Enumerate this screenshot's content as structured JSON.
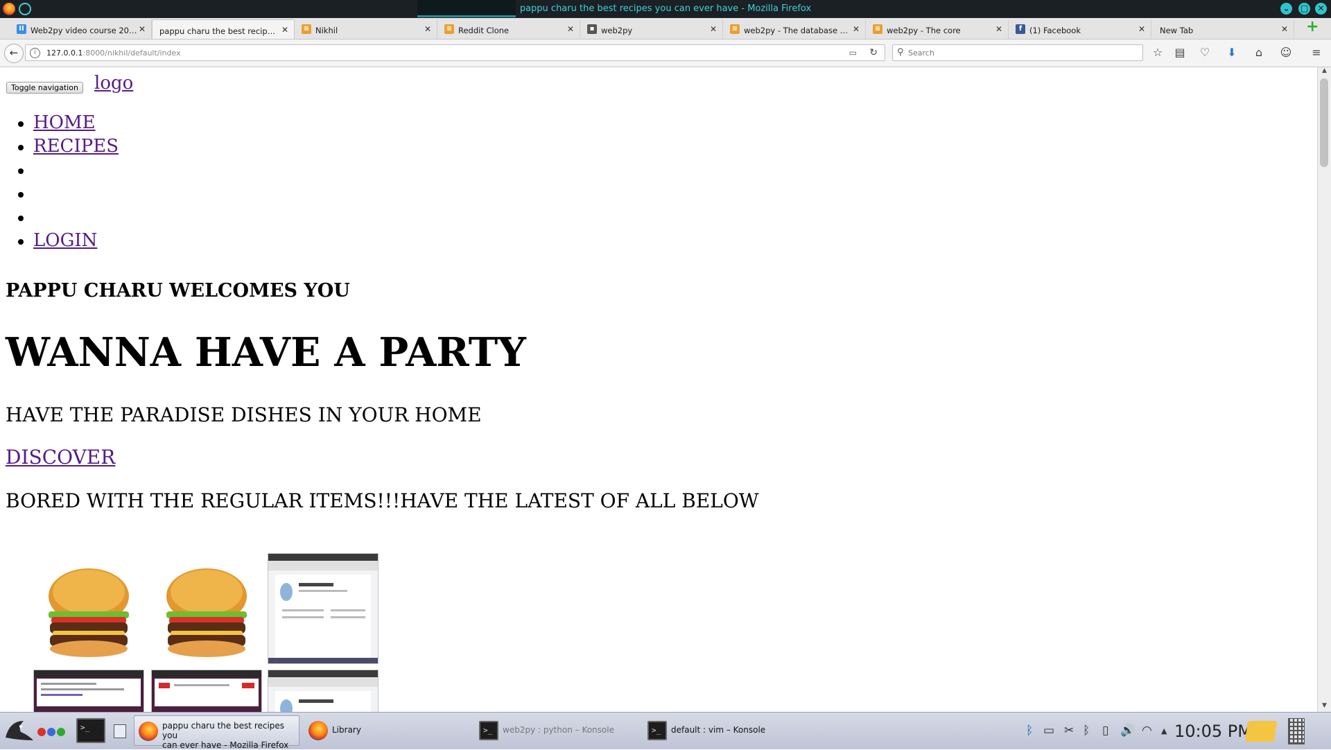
{
  "window": {
    "title": "pappu charu the best recipes you can ever have - Mozilla Firefox"
  },
  "tabs": [
    {
      "label": "Web2py video course 20…",
      "favicon": "video-course-icon",
      "color": "#3a8ee6"
    },
    {
      "label": "pappu charu the best recip…",
      "favicon": "page-icon",
      "active": true
    },
    {
      "label": "Nikhil",
      "favicon": "web2py-icon",
      "color": "#e8a030"
    },
    {
      "label": "Reddit Clone",
      "favicon": "web2py-icon",
      "color": "#e8a030"
    },
    {
      "label": "web2py",
      "favicon": "github-icon",
      "color": "#555555"
    },
    {
      "label": "web2py - The database …",
      "favicon": "web2py-icon",
      "color": "#e8a030"
    },
    {
      "label": "web2py - The core",
      "favicon": "web2py-icon",
      "color": "#e8a030"
    },
    {
      "label": "(1) Facebook",
      "favicon": "facebook-icon",
      "color": "#3b5998"
    },
    {
      "label": "New Tab",
      "favicon": "none"
    }
  ],
  "navbar": {
    "url_host": "127.0.0.1",
    "url_rest": ":8000/nikhil/default/index",
    "search_placeholder": "Search"
  },
  "page": {
    "toggle_label": "Toggle navigation",
    "logo_label": "logo",
    "nav_items": [
      "HOME",
      "RECIPES",
      "",
      "",
      "",
      "LOGIN"
    ],
    "welcome": "PAPPU CHARU WELCOMES YOU",
    "party": "WANNA HAVE A PARTY",
    "paradise": "HAVE THE PARADISE DISHES IN YOUR HOME",
    "discover": "DISCOVER",
    "bored": "BORED WITH THE REGULAR ITEMS!!!HAVE THE LATEST OF ALL BELOW",
    "gallery": [
      "burger-image",
      "burger-image",
      "profile-screenshot-image",
      "browser-screenshot-image",
      "youtube-screenshot-image",
      "profile-screenshot-image"
    ]
  },
  "taskbar": {
    "tasks": [
      {
        "label": "pappu charu the best recipes you can ever have - Mozilla Firefox",
        "line1": "pappu charu the best recipes you",
        "line2": "can ever have - Mozilla Firefox",
        "icon": "firefox-icon",
        "active": true
      },
      {
        "label": "Library",
        "icon": "firefox-icon"
      },
      {
        "label": "web2py : python – Konsole",
        "icon": "terminal-icon",
        "dim": true
      },
      {
        "label": "default : vim – Konsole",
        "icon": "terminal-icon"
      }
    ],
    "clock": "10:05 PM"
  },
  "colors": {
    "link_visited": "#551a8b",
    "titlebar_bg": "#1b2024",
    "titlebar_text": "#3fd0d8",
    "download_arrow": "#2a78d6"
  }
}
